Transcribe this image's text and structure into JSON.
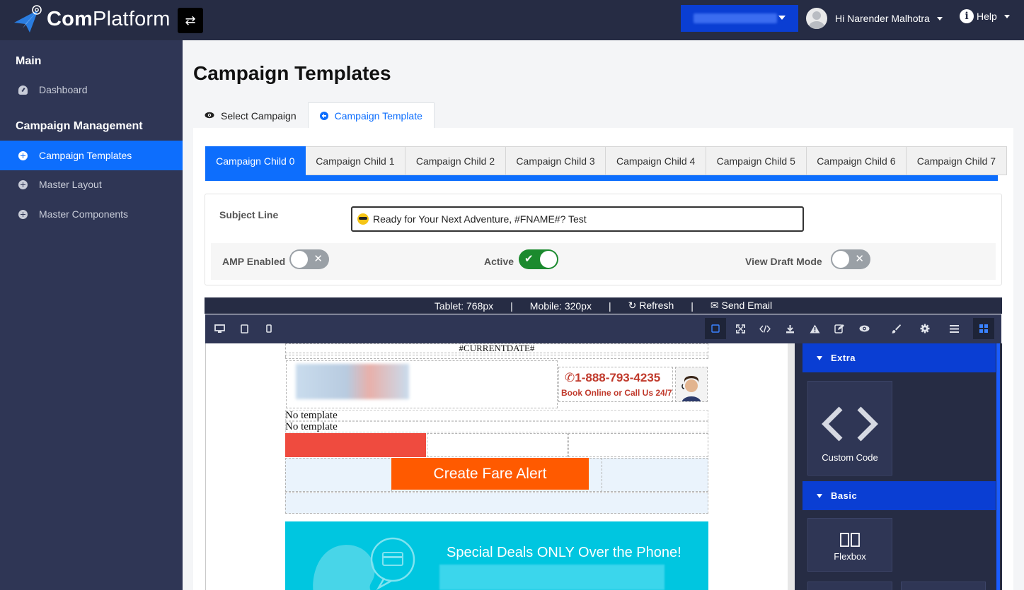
{
  "app": {
    "brand_bold": "Com",
    "brand_light": "Platform",
    "user_greeting": "Hi Narender Malhotra",
    "help_label": "Help"
  },
  "sidebar": {
    "section_main": "Main",
    "section_campaign": "Campaign Management",
    "items": [
      {
        "label": "Dashboard",
        "icon": "dashboard-icon"
      },
      {
        "label": "Campaign Templates",
        "icon": "plus-circle-icon",
        "active": true
      },
      {
        "label": "Master Layout",
        "icon": "plus-circle-icon"
      },
      {
        "label": "Master Components",
        "icon": "plus-circle-icon"
      }
    ]
  },
  "page": {
    "title": "Campaign Templates",
    "tabs": [
      {
        "label": "Select Campaign",
        "icon": "eye-icon"
      },
      {
        "label": "Campaign Template",
        "icon": "plus-circle-icon",
        "active": true
      }
    ]
  },
  "child_tabs": [
    "Campaign Child 0",
    "Campaign Child 1",
    "Campaign Child 2",
    "Campaign Child 3",
    "Campaign Child 4",
    "Campaign Child 5",
    "Campaign Child 6",
    "Campaign Child 7"
  ],
  "form": {
    "subject_label": "Subject Line",
    "subject_value": "Ready for Your Next Adventure, #FNAME#? Test",
    "amp_label": "AMP Enabled",
    "amp_enabled": false,
    "active_label": "Active",
    "active": true,
    "draft_label": "View Draft Mode",
    "draft_mode": false
  },
  "editor": {
    "tablet": "Tablet: 768px",
    "mobile": "Mobile: 320px",
    "sep": "|",
    "refresh": "Refresh",
    "send_email": "Send Email",
    "tools": [
      "desktop-icon",
      "tablet-icon",
      "mobile-icon",
      "select-square-icon",
      "fullscreen-icon",
      "code-icon",
      "download-icon",
      "warning-icon",
      "edit-icon",
      "preview-eye-icon",
      "brush-icon",
      "gear-icon",
      "layers-icon",
      "blocks-icon"
    ]
  },
  "canvas": {
    "current_date": "#CURRENTDATE#",
    "phone": "1-888-793-4235",
    "book_text": "Book Online or Call Us 24/7",
    "no_template_1": "No template",
    "no_template_2": "No template",
    "cta": "Create Fare Alert",
    "banner_text": "Special Deals ONLY Over the Phone!"
  },
  "blocks": {
    "extra_label": "Extra",
    "custom_code": "Custom Code",
    "basic_label": "Basic",
    "flexbox": "Flexbox"
  },
  "colors": {
    "topbar": "#262c44",
    "sidebar": "#2f3655",
    "accent": "#0d6efd",
    "block_header": "#0a3ed3",
    "cta": "#ff5a00",
    "banner": "#00c6e0",
    "phone_red": "#c0392b"
  }
}
